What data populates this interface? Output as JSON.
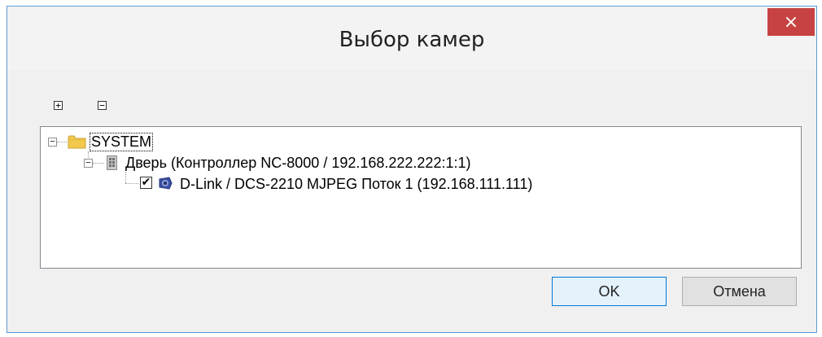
{
  "window": {
    "title": "Выбор камер",
    "close_label": "×"
  },
  "toolbar": {
    "expand_all_label": "+",
    "collapse_all_label": "−"
  },
  "tree": {
    "root": {
      "expander": "−",
      "label": "SYSTEM",
      "icon": "folder-icon",
      "children": [
        {
          "expander": "−",
          "label": "Дверь (Контроллер NC-8000 / 192.168.222.222:1:1)",
          "icon": "door-icon",
          "children": [
            {
              "checked": true,
              "check_mark": "✔",
              "label": "D-Link / DCS-2210 MJPEG Поток 1 (192.168.111.111)",
              "icon": "camera-icon"
            }
          ]
        }
      ]
    }
  },
  "buttons": {
    "ok_label": "OK",
    "cancel_label": "Отмена"
  },
  "colors": {
    "accent": "#0078d7",
    "close_bg": "#c74343",
    "folder": "#f2c94c"
  }
}
